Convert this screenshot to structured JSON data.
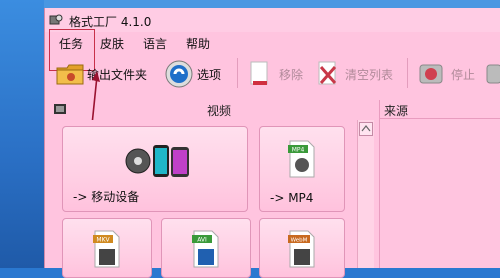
{
  "window": {
    "title": "格式工厂 4.1.0"
  },
  "menu": [
    {
      "label": "任务"
    },
    {
      "label": "皮肤"
    },
    {
      "label": "语言"
    },
    {
      "label": "帮助"
    }
  ],
  "toolbar": {
    "output_folder": "输出文件夹",
    "options": "选项",
    "remove": "移除",
    "clear_list": "清空列表",
    "stop": "停止"
  },
  "left_panel": {
    "header": "视频"
  },
  "tiles": [
    {
      "label": "-> 移动设备"
    },
    {
      "label": "-> MP4"
    }
  ],
  "right_panel": {
    "header": "来源"
  },
  "icons": {
    "file_badges": [
      "MP4",
      "MKV",
      "AVI",
      "WebM"
    ]
  },
  "colors": {
    "accent_red": "#c8304a",
    "window_bg": "#ffc4df",
    "desktop_blue": "#2a78d0"
  }
}
